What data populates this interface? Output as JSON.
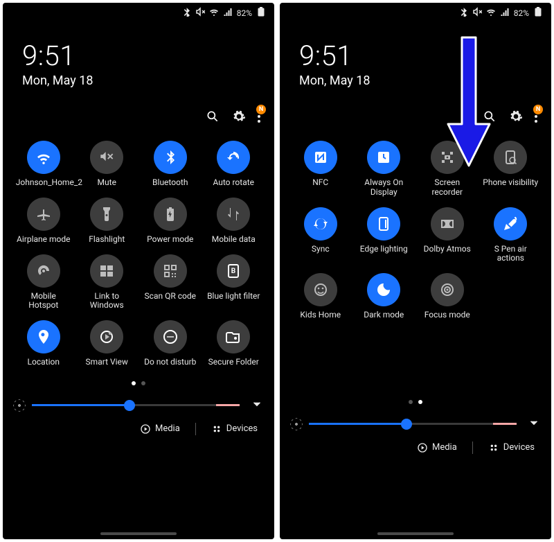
{
  "statusBar": {
    "batteryText": "82%"
  },
  "clock": {
    "time": "9:51",
    "date": "Mon, May 18"
  },
  "badge": "N",
  "pages": [
    {
      "active_index": 0,
      "tiles": [
        {
          "label": "Johnson_Home_2",
          "icon": "wifi",
          "on": true
        },
        {
          "label": "Mute",
          "icon": "mute",
          "on": false
        },
        {
          "label": "Bluetooth",
          "icon": "bluetooth",
          "on": true
        },
        {
          "label": "Auto rotate",
          "icon": "rotate",
          "on": true
        },
        {
          "label": "Airplane mode",
          "icon": "airplane",
          "on": false
        },
        {
          "label": "Flashlight",
          "icon": "flashlight",
          "on": false
        },
        {
          "label": "Power mode",
          "icon": "battery",
          "on": false
        },
        {
          "label": "Mobile data",
          "icon": "data",
          "on": false
        },
        {
          "label": "Mobile Hotspot",
          "icon": "hotspot",
          "on": false
        },
        {
          "label": "Link to Windows",
          "icon": "windows",
          "on": false
        },
        {
          "label": "Scan QR code",
          "icon": "qr",
          "on": false
        },
        {
          "label": "Blue light filter",
          "icon": "bluelight",
          "on": false
        },
        {
          "label": "Location",
          "icon": "location",
          "on": true
        },
        {
          "label": "Smart View",
          "icon": "smartview",
          "on": false
        },
        {
          "label": "Do not disturb",
          "icon": "dnd",
          "on": false
        },
        {
          "label": "Secure Folder",
          "icon": "folder",
          "on": false
        }
      ]
    },
    {
      "active_index": 1,
      "tiles": [
        {
          "label": "NFC",
          "icon": "nfc",
          "on": true
        },
        {
          "label": "Always On Display",
          "icon": "aod",
          "on": true
        },
        {
          "label": "Screen recorder",
          "icon": "recorder",
          "on": false
        },
        {
          "label": "Phone visibility",
          "icon": "visibility",
          "on": false
        },
        {
          "label": "Sync",
          "icon": "sync",
          "on": true
        },
        {
          "label": "Edge lighting",
          "icon": "edge",
          "on": true
        },
        {
          "label": "Dolby Atmos",
          "icon": "dolby",
          "on": false
        },
        {
          "label": "S Pen air actions",
          "icon": "spen",
          "on": true
        },
        {
          "label": "Kids Home",
          "icon": "kids",
          "on": false
        },
        {
          "label": "Dark mode",
          "icon": "darkmode",
          "on": true
        },
        {
          "label": "Focus mode",
          "icon": "focus",
          "on": false
        }
      ]
    }
  ],
  "brightness": {
    "percent": 47
  },
  "bottomBar": {
    "media": "Media",
    "devices": "Devices"
  }
}
